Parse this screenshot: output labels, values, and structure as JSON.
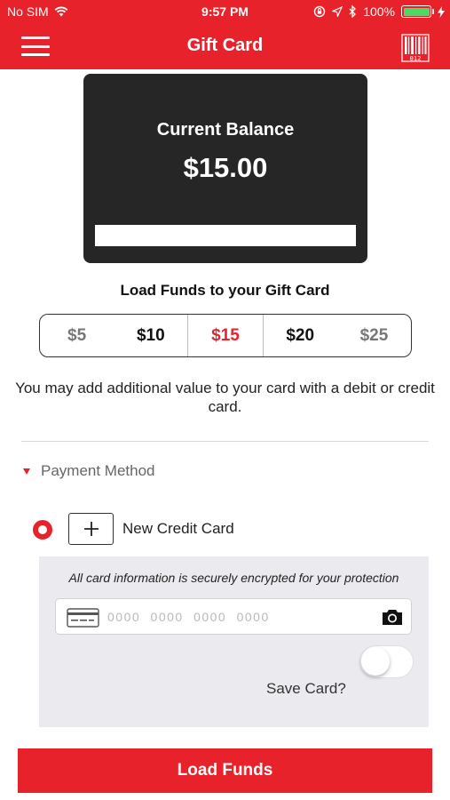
{
  "status_bar": {
    "carrier": "No SIM",
    "time": "9:57 PM",
    "battery": "100%",
    "battery_level": 1.0,
    "icons": [
      "wifi-icon",
      "lock-rotation-icon",
      "location-icon",
      "bluetooth-icon",
      "battery-icon",
      "charging-icon"
    ]
  },
  "nav": {
    "title": "Gift Card",
    "menu_icon": "hamburger-menu-icon",
    "barcode_icon": "barcode-icon",
    "barcode_caption": "012"
  },
  "card": {
    "balance_label": "Current Balance",
    "balance_value": "$15.00"
  },
  "load_funds": {
    "title": "Load Funds to your Gift Card",
    "amounts": [
      "$5",
      "$10",
      "$15",
      "$20",
      "$25"
    ],
    "selected": "$15",
    "info": "You may add additional value to your card with a debit or credit card."
  },
  "payment": {
    "section_label": "Payment Method",
    "new_card_label": "New Credit Card",
    "secure_note": "All card information is securely encrypted for your protection",
    "card_number_placeholder": "0000 0000 0000 0000",
    "save_card_label": "Save Card?",
    "save_card_on": false
  },
  "button": {
    "load_funds": "Load Funds"
  },
  "colors": {
    "accent": "#e8222b",
    "card_bg": "#262626",
    "panel_bg": "#ebebef"
  }
}
